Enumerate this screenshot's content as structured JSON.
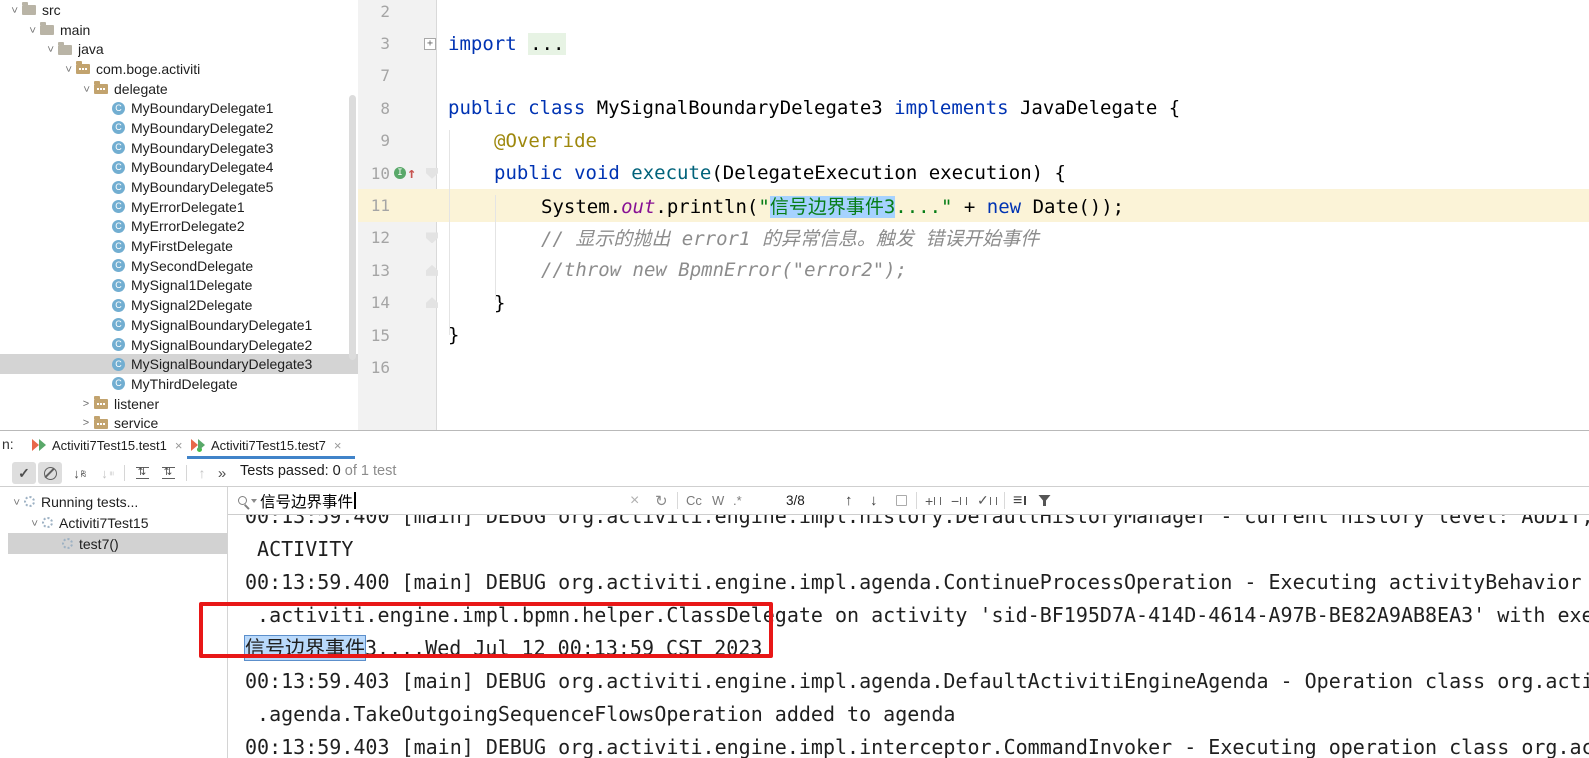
{
  "project_tree": {
    "items": [
      {
        "label": "src",
        "type": "folder"
      },
      {
        "label": "main",
        "type": "folder"
      },
      {
        "label": "java",
        "type": "folder"
      },
      {
        "label": "com.boge.activiti",
        "type": "package"
      },
      {
        "label": "delegate",
        "type": "package"
      },
      {
        "label": "MyBoundaryDelegate1",
        "type": "class"
      },
      {
        "label": "MyBoundaryDelegate2",
        "type": "class"
      },
      {
        "label": "MyBoundaryDelegate3",
        "type": "class"
      },
      {
        "label": "MyBoundaryDelegate4",
        "type": "class"
      },
      {
        "label": "MyBoundaryDelegate5",
        "type": "class"
      },
      {
        "label": "MyErrorDelegate1",
        "type": "class"
      },
      {
        "label": "MyErrorDelegate2",
        "type": "class"
      },
      {
        "label": "MyFirstDelegate",
        "type": "class"
      },
      {
        "label": "MySecondDelegate",
        "type": "class"
      },
      {
        "label": "MySignal1Delegate",
        "type": "class"
      },
      {
        "label": "MySignal2Delegate",
        "type": "class"
      },
      {
        "label": "MySignalBoundaryDelegate1",
        "type": "class"
      },
      {
        "label": "MySignalBoundaryDelegate2",
        "type": "class"
      },
      {
        "label": "MySignalBoundaryDelegate3",
        "type": "class",
        "selected": true
      },
      {
        "label": "MyThirdDelegate",
        "type": "class"
      },
      {
        "label": "listener",
        "type": "package",
        "collapsed": true
      },
      {
        "label": "service",
        "type": "package",
        "collapsed": true
      }
    ]
  },
  "editor": {
    "lines": [
      {
        "num": "2",
        "segments": []
      },
      {
        "num": "3",
        "segments": [
          {
            "text": "import "
          },
          {
            "text": "..."
          }
        ]
      },
      {
        "num": "7",
        "segments": []
      },
      {
        "num": "8",
        "segments": [
          {
            "text": "public class "
          },
          {
            "text": "MySignalBoundaryDelegate3 "
          },
          {
            "text": "implements "
          },
          {
            "text": "JavaDelegate {"
          }
        ]
      },
      {
        "num": "9",
        "segments": [
          {
            "text": "@Override"
          }
        ]
      },
      {
        "num": "10",
        "segments": [
          {
            "text": "public void "
          },
          {
            "text": "execute"
          },
          {
            "text": "(DelegateExecution execution) {"
          }
        ]
      },
      {
        "num": "11",
        "segments": [
          {
            "text": "System."
          },
          {
            "text": "out"
          },
          {
            "text": ".println("
          },
          {
            "text": "\""
          },
          {
            "text": "信号边界事件3"
          },
          {
            "text": "....\""
          },
          {
            "text": " + "
          },
          {
            "text": "new"
          },
          {
            "text": " Date());"
          }
        ]
      },
      {
        "num": "12",
        "segments": [
          {
            "text": "// 显示的抛出 error1 的异常信息。触发 错误开始事件"
          }
        ]
      },
      {
        "num": "13",
        "segments": [
          {
            "text": "//throw new BpmnError(\"error2\");"
          }
        ]
      },
      {
        "num": "14",
        "segments": [
          {
            "text": "}"
          }
        ]
      },
      {
        "num": "15",
        "segments": [
          {
            "text": "}"
          }
        ]
      },
      {
        "num": "16",
        "segments": []
      }
    ]
  },
  "run_panel": {
    "tab_prefix": "n:",
    "tabs": [
      {
        "label": "Activiti7Test15.test1",
        "close": "×"
      },
      {
        "label": "Activiti7Test15.test7",
        "close": "×",
        "active": true
      }
    ],
    "status": {
      "passed": "Tests passed: 0",
      "suffix": " of 1 test"
    },
    "tree": [
      {
        "label": "Running tests..."
      },
      {
        "label": "Activiti7Test15"
      },
      {
        "label": "test7()",
        "selected": true
      }
    ],
    "search": {
      "query": "信号边界事件",
      "match_case": "Cc",
      "words": "W",
      "regex": ".*",
      "count": "3/8"
    },
    "console": {
      "lines": [
        {
          "text": "00:13:59.400 [main] DEBUG org.activiti.engine.impl.history.DefaultHistoryManager - current history level: AUDIT,"
        },
        {
          "text": " ACTIVITY"
        },
        {
          "text": "00:13:59.400 [main] DEBUG org.activiti.engine.impl.agenda.ContinueProcessOperation - Executing activityBehavior"
        },
        {
          "text": " .activiti.engine.impl.bpmn.helper.ClassDelegate on activity 'sid-BF195D7A-414D-4614-A97B-BE82A9AB8EA3' with exe"
        },
        {
          "highlight": "信号边界事件",
          "text": "3....Wed Jul 12 00:13:59 CST 2023"
        },
        {
          "text": "00:13:59.403 [main] DEBUG org.activiti.engine.impl.agenda.DefaultActivitiEngineAgenda - Operation class org.acti"
        },
        {
          "text": " .agenda.TakeOutgoingSequenceFlowsOperation added to agenda"
        },
        {
          "text": "00:13:59.403 [main] DEBUG org.activiti.engine.impl.interceptor.CommandInvoker - Executing operation class org.ac"
        }
      ]
    }
  },
  "colors": {
    "accent_blue": "#4083c9",
    "annotation_red": "#e81717",
    "match_highlight": "#a6d2ff",
    "current_line": "#fbf3d7"
  }
}
